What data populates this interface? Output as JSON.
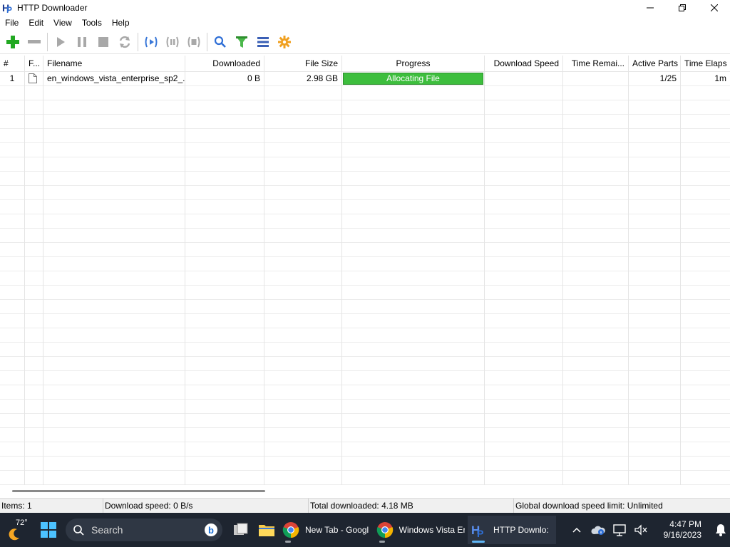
{
  "window": {
    "title": "HTTP Downloader"
  },
  "menu": [
    "File",
    "Edit",
    "View",
    "Tools",
    "Help"
  ],
  "toolbar": {
    "icons": [
      "add-icon",
      "remove-icon",
      "start-icon",
      "pause-icon",
      "stop-icon",
      "restart-icon",
      "start-all-icon",
      "pause-all-icon",
      "stop-all-icon",
      "search-icon",
      "filter-icon",
      "queue-icon",
      "options-icon"
    ]
  },
  "table": {
    "columns": [
      "#",
      "F...",
      "Filename",
      "Downloaded",
      "File Size",
      "Progress",
      "Download Speed",
      "Time Remai...",
      "Active Parts",
      "Time Elaps"
    ],
    "rows": [
      {
        "num": "1",
        "filename": "en_windows_vista_enterprise_sp2_...",
        "downloaded": "0 B",
        "file_size": "2.98 GB",
        "progress_label": "Allocating File",
        "progress_fraction": 1.0,
        "download_speed": "",
        "time_remaining": "",
        "active_parts": "1/25",
        "time_elapsed": "1m"
      }
    ]
  },
  "status": {
    "items": "Items: 1",
    "download_speed": "Download speed: 0 B/s",
    "total_downloaded": "Total downloaded: 4.18 MB",
    "speed_limit": "Global download speed limit: Unlimited"
  },
  "taskbar": {
    "temperature": "72°",
    "search_placeholder": "Search",
    "apps": [
      {
        "label": "New Tab - Googl"
      },
      {
        "label": "Windows Vista Er"
      },
      {
        "label": "HTTP Downlo:"
      }
    ],
    "time": "4:47 PM",
    "date": "9/16/2023"
  },
  "colors": {
    "progress_green": "#3dbe3d",
    "taskbar_bg": "#1e2530"
  }
}
